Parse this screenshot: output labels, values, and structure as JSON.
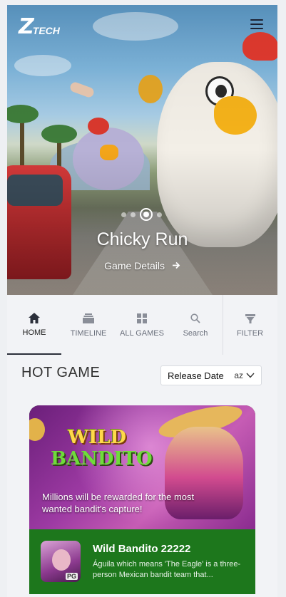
{
  "brand": {
    "logo_text": "TECH",
    "logo_mark": "Z"
  },
  "header": {
    "menu_icon": "hamburger-icon"
  },
  "hero": {
    "title": "Chicky Run",
    "link_label": "Game Details",
    "link_icon": "arrow-right-icon",
    "carousel": {
      "slides": 4,
      "active_index": 2
    }
  },
  "nav": {
    "items": [
      {
        "label": "HOME",
        "icon": "home-icon",
        "active": true
      },
      {
        "label": "TIMELINE",
        "icon": "timeline-icon",
        "active": false
      },
      {
        "label": "ALL GAMES",
        "icon": "grid-icon",
        "active": false
      },
      {
        "label": "Search",
        "icon": "search-icon",
        "active": false
      },
      {
        "label": "FILTER",
        "icon": "filter-icon",
        "active": false
      }
    ]
  },
  "hot_game": {
    "title": "HOT GAME",
    "sort": {
      "label": "Release Date",
      "order": "az",
      "icon": "chevron-down-icon"
    }
  },
  "game_card": {
    "banner_logo_line1": "WILD",
    "banner_logo_line2": "BANDITO",
    "banner_tagline": "Millions will be rewarded for the most wanted bandit's capture!",
    "icon_badge": "PG",
    "name": "Wild Bandito 22222",
    "description": "Águila which means 'The Eagle' is a three-person Mexican bandit team that...",
    "info_color": "#1d771c"
  },
  "colors": {
    "nav_active": "#2b2f3a",
    "background": "#f2f3f6"
  }
}
